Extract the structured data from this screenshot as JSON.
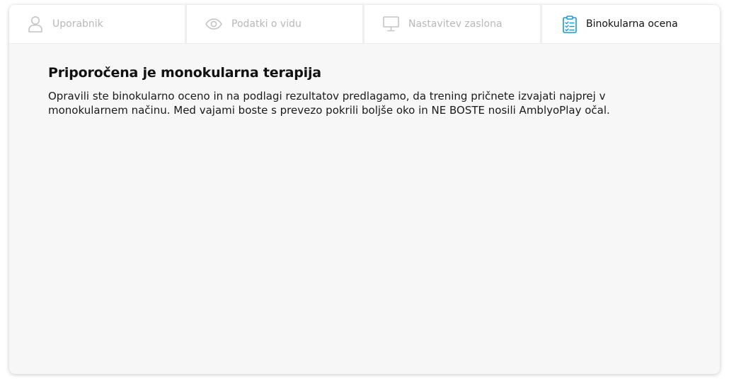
{
  "tabs": [
    {
      "label": "Uporabnik",
      "icon": "user-icon",
      "active": false
    },
    {
      "label": "Podatki o vidu",
      "icon": "eye-icon",
      "active": false
    },
    {
      "label": "Nastavitev zaslona",
      "icon": "monitor-icon",
      "active": false
    },
    {
      "label": "Binokularna ocena",
      "icon": "clipboard-checklist-icon",
      "active": true
    }
  ],
  "main": {
    "title": "Priporočena je monokularna terapija",
    "description": "Opravili ste binokularno oceno in na podlagi rezultatov predlagamo, da trening pričnete izvajati najprej v monokularnem načinu. Med vajami boste s prevezo pokrili boljše oko in NE BOSTE nosili AmblyoPlay očal."
  },
  "colors": {
    "accent": "#1a9ad6",
    "inactive": "#b8b8b8",
    "background": "#f7f7f7"
  }
}
